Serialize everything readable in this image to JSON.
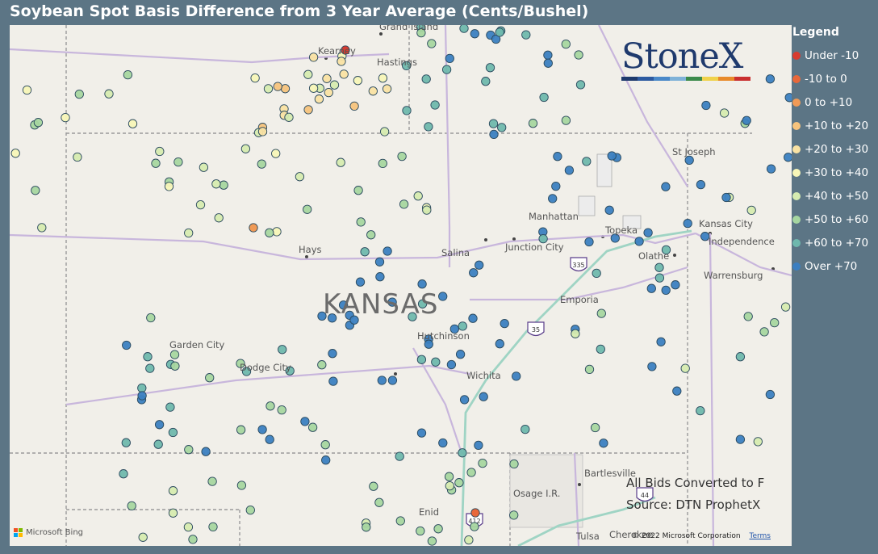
{
  "title": "Soybean Spot Basis Difference from 3 Year Average (Cents/Bushel)",
  "legend": {
    "title": "Legend",
    "items": [
      {
        "label": "Under -10",
        "color": "#d83b30"
      },
      {
        "label": "-10 to 0",
        "color": "#e8683a"
      },
      {
        "label": "0 to +10",
        "color": "#f09a56"
      },
      {
        "label": "+10 to +20",
        "color": "#f6c37d"
      },
      {
        "label": "+20 to +30",
        "color": "#f9e2a3"
      },
      {
        "label": "+30 to +40",
        "color": "#f7f6b8"
      },
      {
        "label": "+40 to +50",
        "color": "#d6ebb0"
      },
      {
        "label": "+50 to +60",
        "color": "#a6d6a0"
      },
      {
        "label": "+60 to +70",
        "color": "#6fb8ad"
      },
      {
        "label": "Over +70",
        "color": "#3b7fc1"
      }
    ]
  },
  "map": {
    "state_label": "KANSAS",
    "cities": [
      {
        "name": "Grand Island"
      },
      {
        "name": "Kearney"
      },
      {
        "name": "Hastings"
      },
      {
        "name": "St Joseph"
      },
      {
        "name": "Manhattan"
      },
      {
        "name": "Topeka"
      },
      {
        "name": "Kansas City"
      },
      {
        "name": "Independence"
      },
      {
        "name": "Hays"
      },
      {
        "name": "Junction City"
      },
      {
        "name": "Salina"
      },
      {
        "name": "Olathe"
      },
      {
        "name": "Warrensburg"
      },
      {
        "name": "Emporia"
      },
      {
        "name": "Garden City"
      },
      {
        "name": "Dodge City"
      },
      {
        "name": "Hutchinson"
      },
      {
        "name": "Wichita"
      },
      {
        "name": "Bartlesville"
      },
      {
        "name": "Osage I.R."
      },
      {
        "name": "Enid"
      },
      {
        "name": "Tulsa"
      },
      {
        "name": "Cherokee"
      }
    ],
    "highway_shields": [
      "335",
      "35",
      "44",
      "412"
    ]
  },
  "logo": {
    "text": "StoneX",
    "colors": [
      "#1f3a6d",
      "#2d5aa0",
      "#4a88c8",
      "#7fb2d8",
      "#3b8a4a",
      "#f0d24a",
      "#e88a2a",
      "#c92f2f"
    ]
  },
  "notes": [
    "All Bids Converted to F",
    "Source: DTN ProphetX"
  ],
  "attribution": {
    "bing": "Microsoft Bing",
    "copyright": "© 2022 Microsoft Corporation",
    "terms": "Terms"
  }
}
